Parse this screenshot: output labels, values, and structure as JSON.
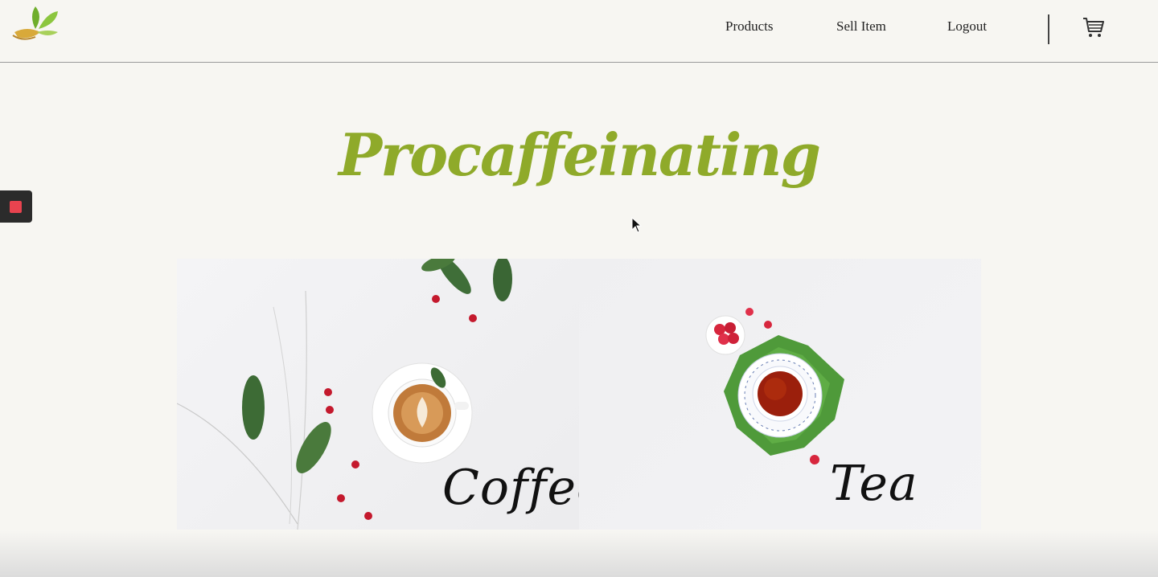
{
  "nav": {
    "items": [
      {
        "label": "Products"
      },
      {
        "label": "Sell Item"
      },
      {
        "label": "Logout"
      }
    ],
    "cart_icon": "cart-icon",
    "logo_icon": "leaf-cup-logo"
  },
  "hero": {
    "title": "Procaffeinating"
  },
  "categories": [
    {
      "label": "Coffee"
    },
    {
      "label": "Tea"
    }
  ],
  "colors": {
    "background": "#f7f6f2",
    "title": "#8faa2a",
    "recording_stop": "#e8434f"
  }
}
